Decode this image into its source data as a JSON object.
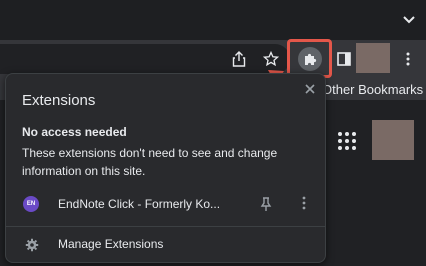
{
  "toolbar": {
    "other_bookmarks": "Other Bookmarks"
  },
  "popup": {
    "title": "Extensions",
    "section_heading": "No access needed",
    "section_description": "These extensions don't need to see and change information on this site.",
    "extensions": [
      {
        "badge": "EN",
        "name": "EndNote Click - Formerly Ko..."
      }
    ],
    "manage_label": "Manage Extensions"
  },
  "colors": {
    "highlight": "#e4574a",
    "extension_badge": "#6a4ac6",
    "popup_bg": "#292a2d"
  },
  "icons": [
    "chevron-down-icon",
    "share-icon",
    "star-icon",
    "puzzle-icon",
    "side-panel-icon",
    "kebab-icon",
    "close-icon",
    "pin-icon",
    "gear-icon",
    "apps-grid-icon"
  ]
}
